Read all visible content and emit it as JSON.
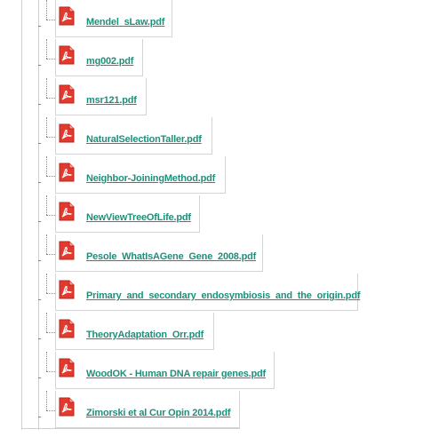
{
  "files": [
    {
      "name": "Mendel_sLaw.pdf"
    },
    {
      "name": "mg002.pdf"
    },
    {
      "name": "msr121.pdf"
    },
    {
      "name": "NaturalSelectionTaller.pdf"
    },
    {
      "name": "Neighbor-JoiningMethod.pdf"
    },
    {
      "name": "NewViewTreeOfLife.pdf"
    },
    {
      "name": "Pesole_WhatIsAGene_Gene_2008.pdf"
    },
    {
      "name": "Primary_and_secondary_endosymbiosis_and_the_origin.pdf"
    },
    {
      "name": "TheoryAdaptation_Orr.pdf"
    },
    {
      "name": "WoodOK - Human DNA repair genes.pdf"
    },
    {
      "name": "Zimorski et al Cur Opin 2014.pdf"
    }
  ],
  "icon": "pdf-file-icon",
  "colors": {
    "link": "#1f8f7a",
    "icon_red": "#d0302b",
    "border": "#d4d4d4"
  }
}
